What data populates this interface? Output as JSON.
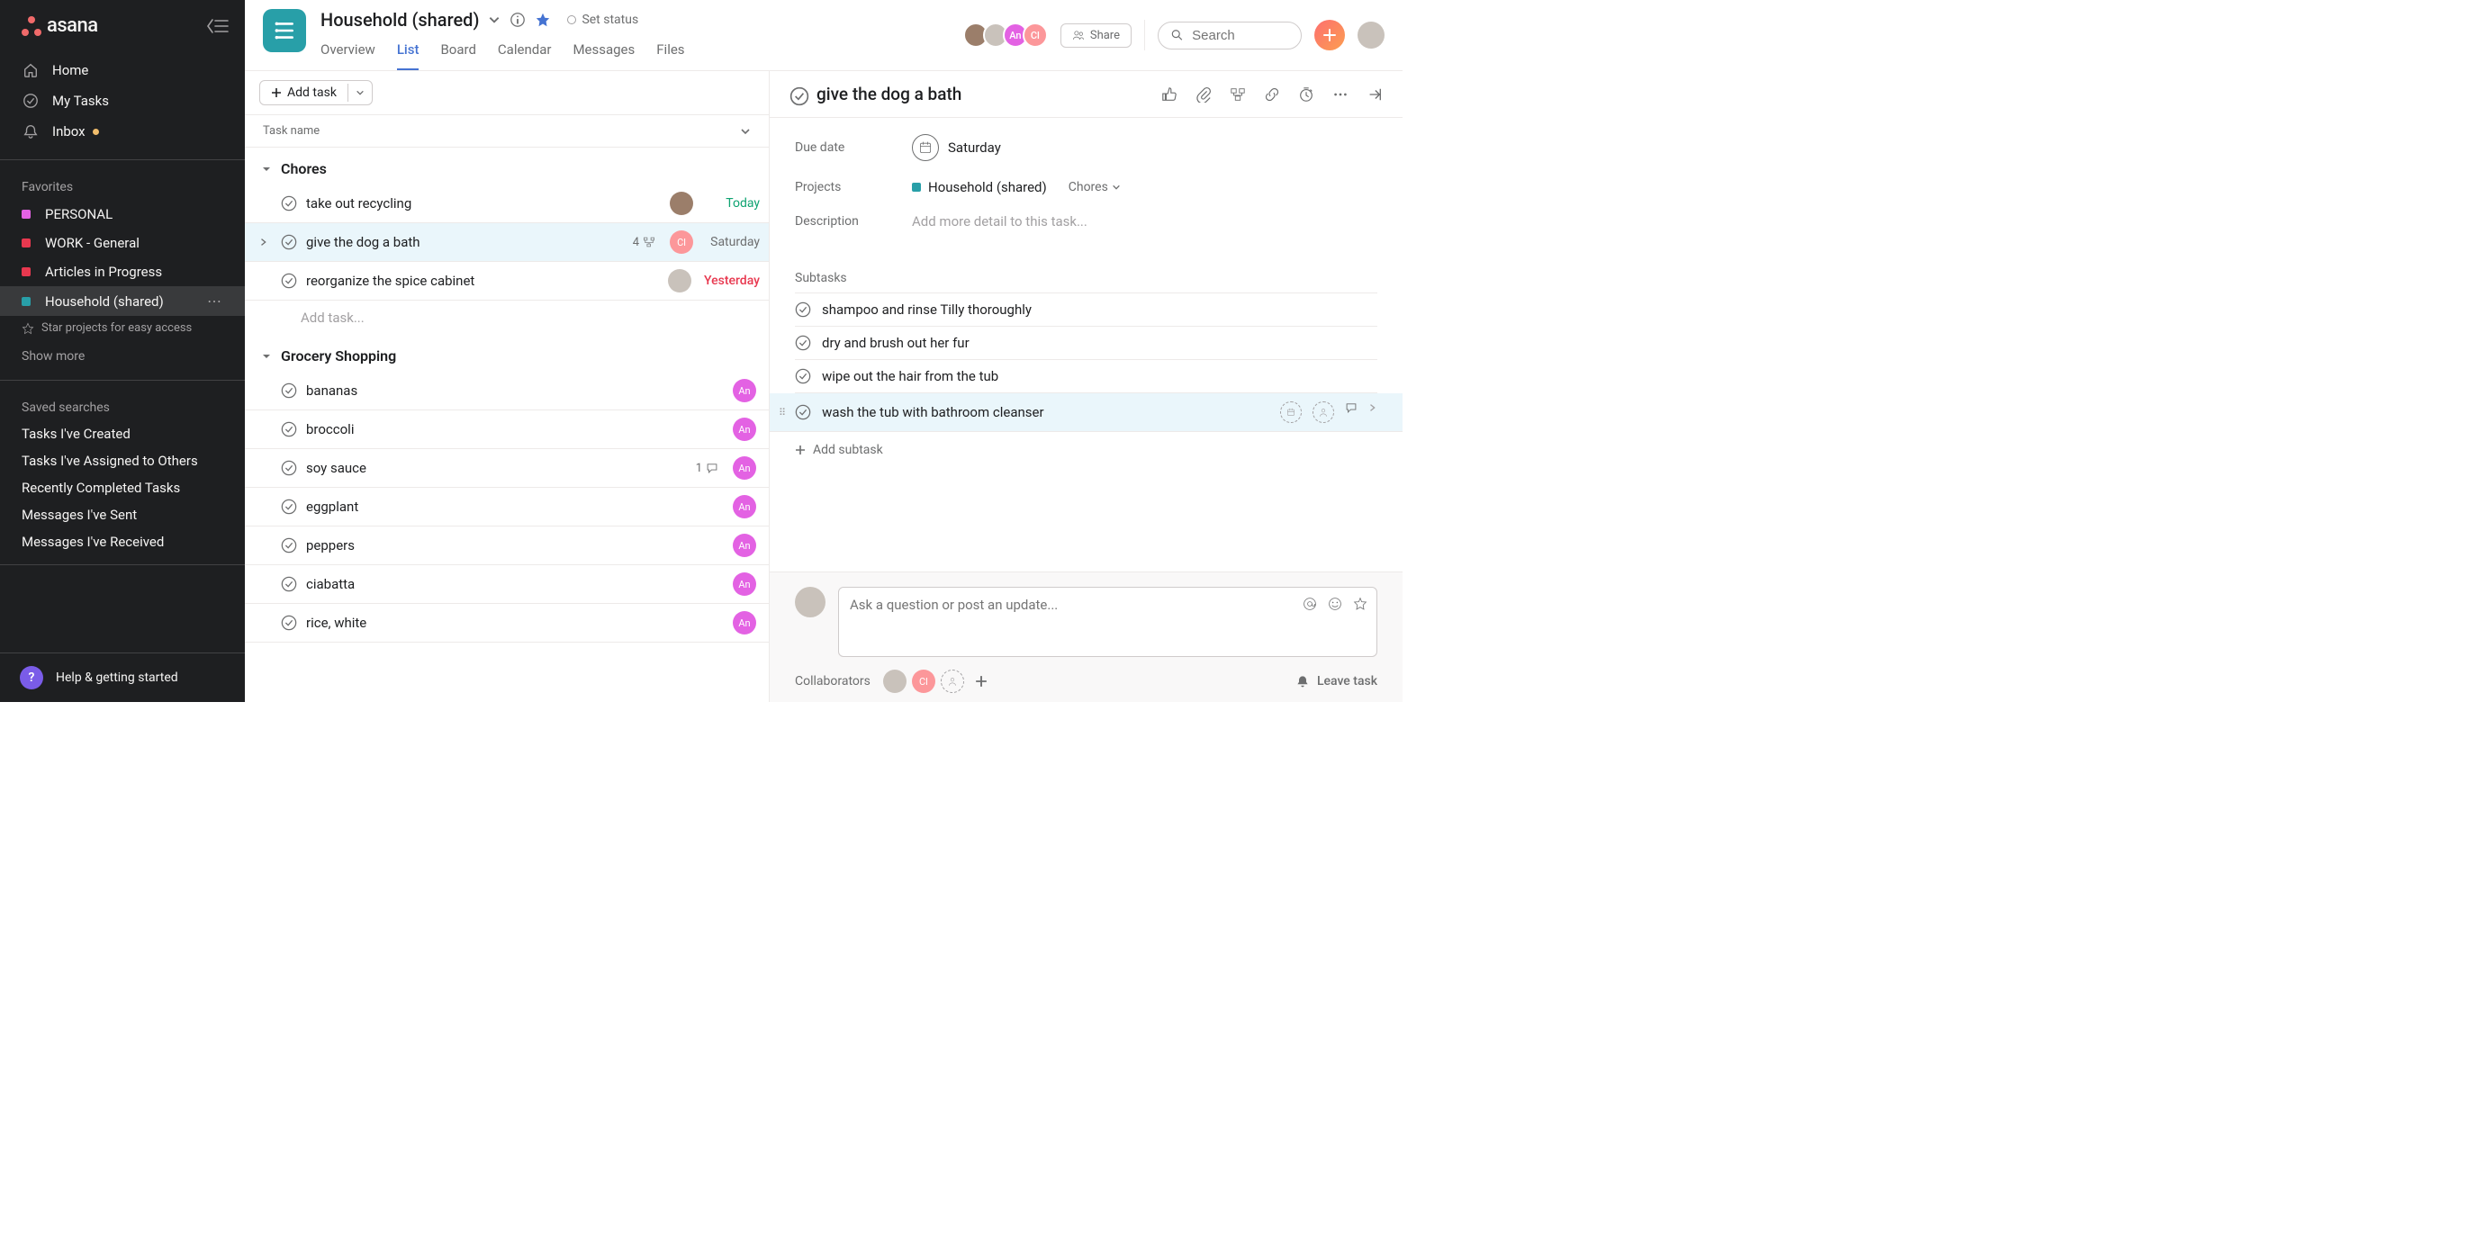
{
  "logoText": "asana",
  "nav": {
    "home": "Home",
    "myTasks": "My Tasks",
    "inbox": "Inbox"
  },
  "favorites": {
    "label": "Favorites",
    "items": [
      {
        "name": "PERSONAL",
        "color": "#e362e3"
      },
      {
        "name": "WORK - General",
        "color": "#e8384f"
      },
      {
        "name": "Articles in Progress",
        "color": "#e8384f"
      },
      {
        "name": "Household (shared)",
        "color": "#289fa8"
      }
    ],
    "starHint": "Star projects for easy access",
    "showMore": "Show more"
  },
  "savedSearches": {
    "label": "Saved searches",
    "items": [
      "Tasks I've Created",
      "Tasks I've Assigned to Others",
      "Recently Completed Tasks",
      "Messages I've Sent",
      "Messages I've Received"
    ]
  },
  "help": "Help & getting started",
  "project": {
    "title": "Household (shared)",
    "setStatus": "Set status",
    "tabs": [
      "Overview",
      "List",
      "Board",
      "Calendar",
      "Messages",
      "Files"
    ],
    "activeTab": "List",
    "share": "Share",
    "searchPlaceholder": "Search"
  },
  "list": {
    "addTask": "Add task",
    "columnHeader": "Task name",
    "addTaskInline": "Add task...",
    "sections": [
      {
        "name": "Chores",
        "tasks": [
          {
            "name": "take out recycling",
            "assigneeType": "img1",
            "due": "Today",
            "dueClass": "today"
          },
          {
            "name": "give the dog a bath",
            "subCount": "4",
            "assigneeType": "cl",
            "due": "Saturday",
            "dueClass": "saturday",
            "selected": true,
            "hasSub": true
          },
          {
            "name": "reorganize the spice cabinet",
            "assigneeType": "img2",
            "due": "Yesterday",
            "dueClass": "yesterday"
          }
        ]
      },
      {
        "name": "Grocery Shopping",
        "tasks": [
          {
            "name": "bananas",
            "assigneeType": "an"
          },
          {
            "name": "broccoli",
            "assigneeType": "an"
          },
          {
            "name": "soy sauce",
            "commentCount": "1",
            "assigneeType": "an"
          },
          {
            "name": "eggplant",
            "assigneeType": "an"
          },
          {
            "name": "peppers",
            "assigneeType": "an"
          },
          {
            "name": "ciabatta",
            "assigneeType": "an"
          },
          {
            "name": "rice, white",
            "assigneeType": "an"
          }
        ]
      }
    ]
  },
  "detail": {
    "title": "give the dog a bath",
    "dueLabel": "Due date",
    "dueValue": "Saturday",
    "projectsLabel": "Projects",
    "projectName": "Household (shared)",
    "sectionName": "Chores",
    "descriptionLabel": "Description",
    "descriptionPlaceholder": "Add more detail to this task...",
    "subtasksLabel": "Subtasks",
    "subtasks": [
      {
        "name": "shampoo and rinse Tilly thoroughly"
      },
      {
        "name": "dry and brush out her fur"
      },
      {
        "name": "wipe out the hair from the tub"
      },
      {
        "name": "wash the tub with bathroom cleanser",
        "highlight": true
      }
    ],
    "addSubtask": "Add subtask",
    "commentPlaceholder": "Ask a question or post an update...",
    "collaboratorsLabel": "Collaborators",
    "leaveTask": "Leave task"
  },
  "assigneeLabels": {
    "an": "An",
    "cl": "Cl"
  }
}
